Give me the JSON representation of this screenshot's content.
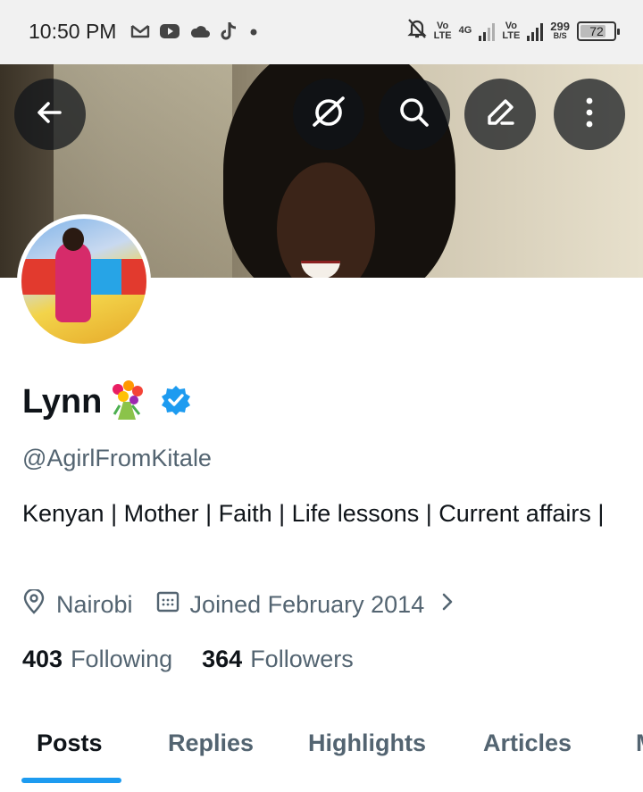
{
  "status_bar": {
    "time": "10:50 PM",
    "notification_icons": [
      "gmail-icon",
      "youtube-icon",
      "cloud-icon",
      "tiktok-icon",
      "dot-icon"
    ],
    "sim1_label_top": "Vo",
    "sim1_label_bottom": "LTE",
    "network_type": "4G",
    "sim2_label_top": "Vo",
    "sim2_label_bottom": "LTE",
    "data_speed_value": "299",
    "data_speed_unit": "B/S",
    "battery_level": "72"
  },
  "header": {
    "back_icon": "arrow-left-icon",
    "grok_icon": "grok-icon",
    "search_icon": "search-icon",
    "edit_icon": "edit-icon",
    "more_icon": "more-vertical-icon"
  },
  "profile": {
    "name": "Lynn",
    "name_emoji": "💐",
    "verified": true,
    "verified_color": "#1d9bf0",
    "handle": "@AgirlFromKitale",
    "bio": "Kenyan | Mother | Faith | Life lessons | Current affairs |",
    "location": "Nairobi",
    "joined": "Joined February 2014",
    "following_count": "403",
    "following_label": "Following",
    "followers_count": "364",
    "followers_label": "Followers"
  },
  "tabs": [
    {
      "label": "Posts",
      "active": true
    },
    {
      "label": "Replies",
      "active": false
    },
    {
      "label": "Highlights",
      "active": false
    },
    {
      "label": "Articles",
      "active": false
    },
    {
      "label": "M",
      "active": false
    }
  ],
  "colors": {
    "accent": "#1d9bf0",
    "text_primary": "#0f1419",
    "text_secondary": "#536471"
  }
}
